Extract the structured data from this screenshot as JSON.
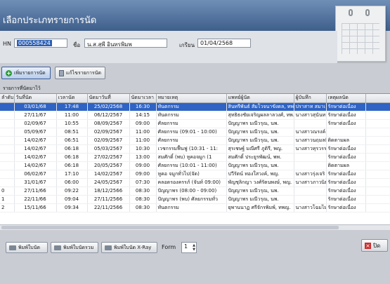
{
  "window": {
    "title": "เลือกประเภทรายการนัด"
  },
  "form": {
    "hn_label": "HN",
    "hn_value": "000558424",
    "name_label": "ชื่อ",
    "name_value": "น.ส.สุพี อินทรพิมพ",
    "birth_label": "เกรียน",
    "birth_value": "01/04/2568"
  },
  "toolbar": {
    "add_label": "เพิ่มรายการนัด",
    "edit_label": "แก้ไขรายการนัด"
  },
  "section_label": "รายการที่นัดมาไว้",
  "table": {
    "columns": [
      "ลำดับ",
      "วันที่นัด",
      "เวลานัด",
      "นัดมาวันที่",
      "นัดมาเวลา",
      "หมายเหตุ",
      "แพทย์ผู้นัด",
      "ผู้บันทึก",
      "เหตุผลนัด",
      ""
    ],
    "rows": [
      [
        "",
        "03/01/68",
        "17:48",
        "25/02/2568",
        "16:30",
        "ทันตกรรม",
        "สินทรีพันธ์ สัมโวจนาขังดล, ทพ.",
        "ปราสาท สมาเ",
        "รักษาต่อเนื่อง",
        ""
      ],
      [
        "",
        "27/11/67",
        "11:00",
        "06/12/2567",
        "14:15",
        "ทันตกรรม",
        "สุทธิธงชัยเจริญผลลาลวงศ์, ทพ.",
        "นางสาวสุนันทา",
        "รักษาต่อเนื่อง",
        ""
      ],
      [
        "",
        "02/09/67",
        "10:55",
        "08/09/2567",
        "09:00",
        "ศัลยกรรม",
        "ปัญญาพร มณีวรุณ, นพ.",
        "",
        "รักษาต่อเนื่อง",
        ""
      ],
      [
        "",
        "05/09/67",
        "08:51",
        "02/09/2567",
        "11:00",
        "ศัลยกรรม (09:01 - 10:00)",
        "ปัญญาพร มณีวรุณ, นพ.",
        "นางสาวณรงค์",
        "",
        ""
      ],
      [
        "",
        "14/02/67",
        "06:51",
        "02/09/2567",
        "11:00",
        "ศัลยกรรม",
        "ปัญญาพร มณีวรุณ, นพ.",
        "นางสาวนฤมลยิ",
        "ติดตามผล",
        ""
      ],
      [
        "",
        "14/02/67",
        "06:18",
        "05/03/2567",
        "10:30",
        "เวชกรรมฟื้นฟู (10:31 - 11:",
        "สุรเชษฐ์ มณีศรี ภูติรี, พญ.",
        "นางสาวทุรวรรณ",
        "รักษาต่อเนื่อง",
        ""
      ],
      [
        "",
        "14/02/67",
        "06:18",
        "27/02/2567",
        "13:00",
        "สมศักดิ์ (พบ) หูคอจมูก (1",
        "สมศักดิ์ ประยูรพัฒน์, พพ.",
        "",
        "รักษาต่อเนื่อง",
        ""
      ],
      [
        "",
        "14/02/67",
        "06:18",
        "20/05/2567",
        "09:00",
        "ศัลยกรรม (10:01 - 11:00)",
        "ปัญญาพร มณีวรุณ, นพ.",
        "",
        "ติดตามผล",
        ""
      ],
      [
        "",
        "06/02/67",
        "17:10",
        "14/02/2567",
        "09:00",
        "หูคอ จมูกทั่วไป(จัด)",
        "ปวีรัตน์ ทองใสวงค์, พญ.",
        "นางสาวรุ่งเจริ",
        "รักษาต่อเนื่อง",
        ""
      ],
      [
        "",
        "31/01/67",
        "06:00",
        "24/05/2567",
        "07:30",
        "คลอดรองครรภ์ (จันท์ 09:00)",
        "พัญชุลิกญา วงศ์รัตนพงษ์, พญ.",
        "นางสาวภาวนิย",
        "รักษาต่อเนื่อง",
        ""
      ],
      [
        "0",
        "27/11/66",
        "09:22",
        "18/12/2566",
        "08:30",
        "ปัญญาพร (08:00 - 09:00)",
        "ปัญญาพร มณีวรุณ, นพ.",
        "",
        "รักษาต่อเนื่อง",
        ""
      ],
      [
        "1",
        "22/11/66",
        "09:04",
        "27/11/2566",
        "08:30",
        "ปัญญาพร (พบ) ศัลยกรรมทั่ว",
        "ปัญญาพร มณีวรุณ, นพ.",
        "",
        "รักษาต่อเนื่อง",
        ""
      ],
      [
        "2",
        "15/11/66",
        "09:34",
        "22/11/2566",
        "08:30",
        "ทันตกรรม",
        "ยุพานนาฏ ศรีจักรพิมพ์, ทพญ.",
        "นางสาวโฉมไม",
        "รักษาต่อเนื่อง",
        ""
      ]
    ]
  },
  "bottombar": {
    "print_appt_label": "พิมพ์ใบนัด",
    "print_summary_label": "พิมพ์ใบนัดรวม",
    "print_xray_label": "พิมพ์ใบนัด X-Ray",
    "form_label": "Form",
    "form_value": "1",
    "close_label": "ปิด"
  }
}
